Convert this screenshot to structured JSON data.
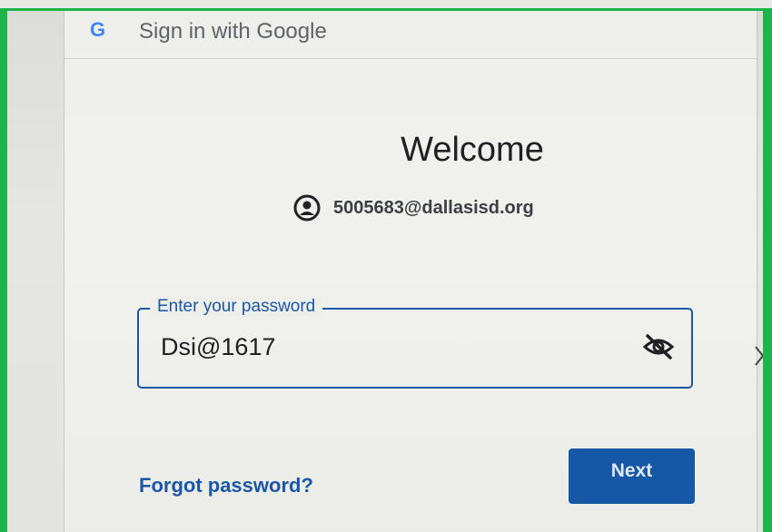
{
  "header": {
    "logo_letter": "G",
    "title": "Sign in with Google"
  },
  "main": {
    "heading": "Welcome",
    "account_email": "5005683@dallasisd.org",
    "account_icon": "account-circle-icon"
  },
  "password_field": {
    "label": "Enter your password",
    "value": "Dsi@1617",
    "toggle_icon": "visibility-off-icon"
  },
  "actions": {
    "forgot_label": "Forgot password?",
    "next_label": "Next"
  },
  "colors": {
    "primary": "#1a57a8",
    "button": "#1657a6",
    "frame": "#1db54a"
  }
}
